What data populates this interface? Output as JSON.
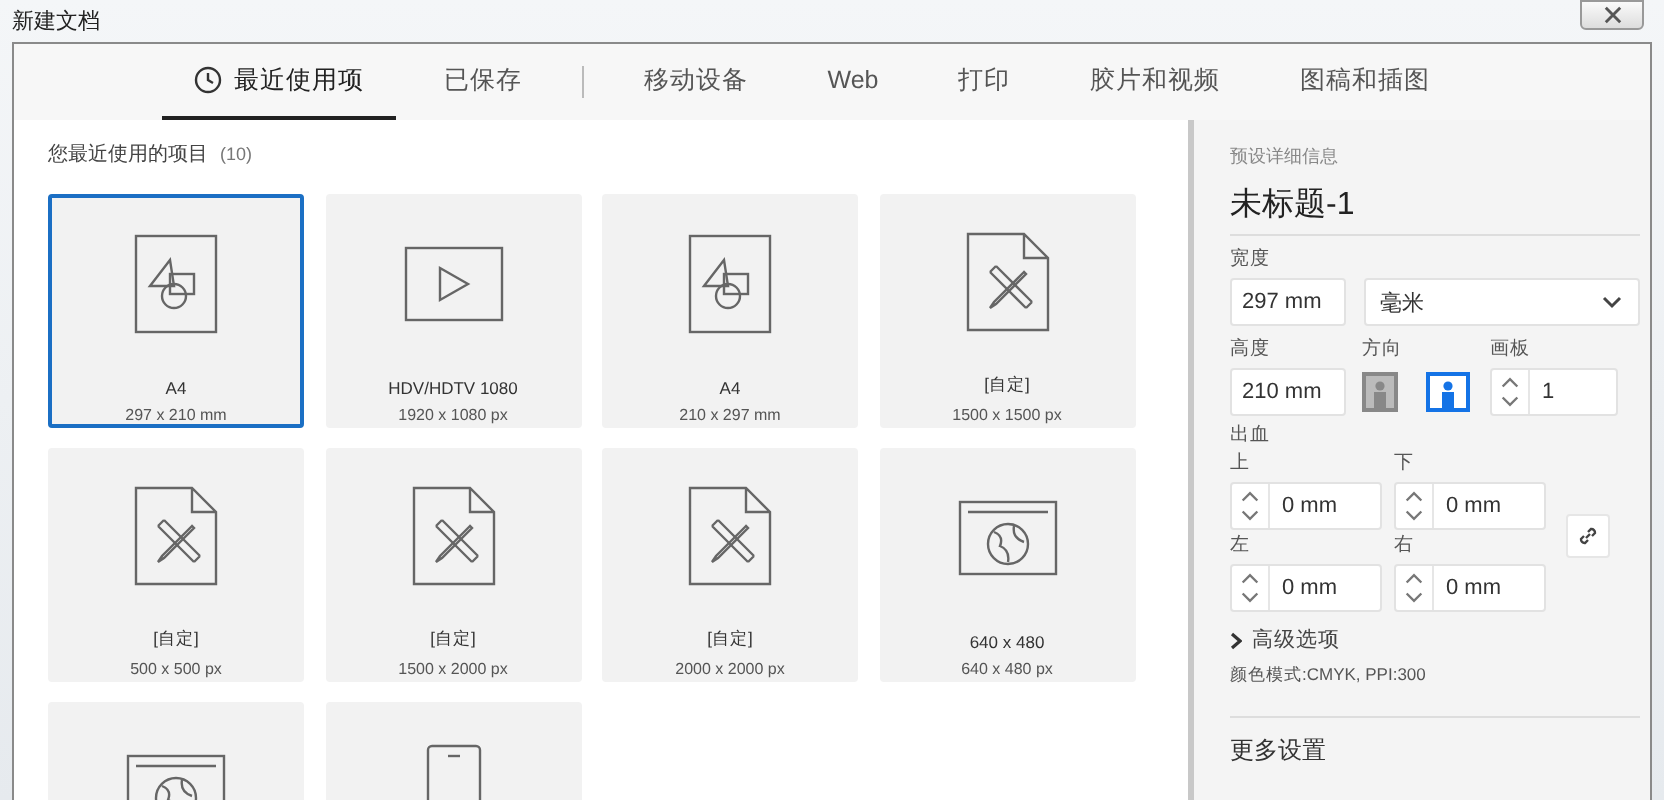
{
  "window": {
    "title": "新建文档"
  },
  "tab_groups": [
    [
      {
        "label": "最近使用项",
        "selected": true
      },
      {
        "label": "已保存",
        "selected": false
      }
    ],
    [
      {
        "label": "移动设备",
        "selected": false
      },
      {
        "label": "Web",
        "selected": false
      },
      {
        "label": "打印",
        "selected": false
      },
      {
        "label": "胶片和视频",
        "selected": false
      },
      {
        "label": "图稿和插图",
        "selected": false
      }
    ]
  ],
  "recent": {
    "heading": "您最近使用的项目",
    "count": "(10)",
    "presets": [
      {
        "kind": "shapes",
        "name": "A4",
        "size": "297 x 210 mm",
        "selected": true
      },
      {
        "kind": "video",
        "name": "HDV/HDTV 1080",
        "size": "1920 x 1080 px",
        "selected": false
      },
      {
        "kind": "shapes",
        "name": "A4",
        "size": "210 x 297 mm",
        "selected": false
      },
      {
        "kind": "custom",
        "name": "[自定]",
        "size": "1500 x 1500 px",
        "selected": false
      },
      {
        "kind": "custom",
        "name": "[自定]",
        "size": "500 x 500 px",
        "selected": false
      },
      {
        "kind": "custom",
        "name": "[自定]",
        "size": "1500 x 2000 px",
        "selected": false
      },
      {
        "kind": "custom",
        "name": "[自定]",
        "size": "2000 x 2000 px",
        "selected": false
      },
      {
        "kind": "web",
        "name": "640 x 480",
        "size": "640 x 480 px",
        "selected": false
      },
      {
        "kind": "web",
        "selected": false
      },
      {
        "kind": "phone",
        "selected": false
      }
    ]
  },
  "details": {
    "heading": "预设详细信息",
    "name": "未标题-1",
    "width_label": "宽度",
    "width": "297 mm",
    "unit": "毫米",
    "height_label": "高度",
    "height": "210 mm",
    "orientation_label": "方向",
    "orientations": [
      {
        "kind": "portrait",
        "selected": false
      },
      {
        "kind": "landscape",
        "selected": true
      }
    ],
    "artboards_label": "画板",
    "artboards": "1",
    "bleed_label": "出血",
    "bleed": [
      {
        "label": "上",
        "value": "0 mm"
      },
      {
        "label": "下",
        "value": "0 mm"
      },
      {
        "label": "左",
        "value": "0 mm"
      },
      {
        "label": "右",
        "value": "0 mm"
      }
    ],
    "advanced": "高级选项",
    "color_mode": "颜色模式:CMYK, PPI:300",
    "more": "更多设置"
  }
}
